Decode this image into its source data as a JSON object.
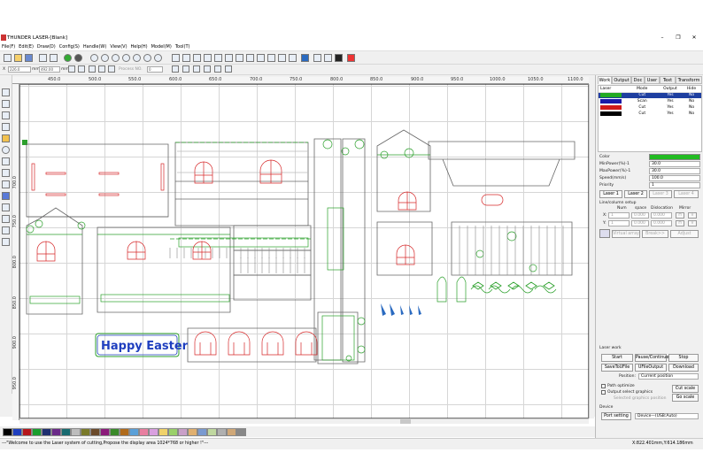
{
  "title": "THUNDER LASER-[Blank]",
  "window_controls": [
    "–",
    "❐",
    "✕"
  ],
  "menu": [
    "File(F)",
    "Edit(E)",
    "Draw(D)",
    "Config(S)",
    "Handle(W)",
    "View(V)",
    "Help(H)",
    "Model(M)",
    "Tool(T)"
  ],
  "toolbar2": {
    "x_label": "X",
    "x_val": "226.0",
    "x_unit": "mm",
    "y_label": "Y",
    "y_val": "320",
    "w_val": "492.00",
    "h_val": "138.966",
    "unit": "mm",
    "process_label": "Process NO.",
    "process_val": "0"
  },
  "ruler_top": [
    "450.0",
    "500.0",
    "550.0",
    "600.0",
    "650.0",
    "700.0",
    "750.0",
    "800.0",
    "850.0",
    "900.0",
    "950.0",
    "1000.0",
    "1050.0",
    "1100.0"
  ],
  "ruler_left": [
    "700.0",
    "750.0",
    "800.0",
    "850.0",
    "900.0",
    "950.0"
  ],
  "canvas_text": {
    "happy_easter": "Happy Easter"
  },
  "palette": [
    "#000000",
    "#1f3fbf",
    "#b5161b",
    "#1b9e2e",
    "#1f2f70",
    "#6a2a88",
    "#186b70",
    "#bdbdbd",
    "#7a7a2a",
    "#6b4a2b",
    "#8b1a7a",
    "#3a8a2a",
    "#b06a1a",
    "#5aa0d8",
    "#e87fa0",
    "#d9a0e0",
    "#f0d26a",
    "#9ad06a",
    "#c9a0c8",
    "#e0b070",
    "#7a9ad0",
    "#c0d8a0",
    "#b0b0b0",
    "#d0a878",
    "#888888"
  ],
  "status": {
    "message": "---\"Welcome to use the Laser system of cutting,Propose the display area 1024*768 or higher !\"---",
    "coords": "X:822.401mm,Y:614.186mm"
  },
  "panel": {
    "tabs": [
      "Work",
      "Output",
      "Doc",
      "User",
      "Text",
      "Transform"
    ],
    "layer_headers": [
      "Laser",
      "Mode",
      "Output",
      "Hide"
    ],
    "layers": [
      {
        "color": "#22aa22",
        "mode": "Cut",
        "output": "Yes",
        "hide": "No",
        "selected": true
      },
      {
        "color": "#1a1aa8",
        "mode": "Scan",
        "output": "Yes",
        "hide": "No",
        "selected": false
      },
      {
        "color": "#d01a1a",
        "mode": "Cut",
        "output": "Yes",
        "hide": "No",
        "selected": false
      },
      {
        "color": "#000000",
        "mode": "Cut",
        "output": "Yes",
        "hide": "No",
        "selected": false
      }
    ],
    "color_label": "Color",
    "color_value": "#22bb22",
    "min_power_label": "MinPower(%)-1",
    "min_power": "30.0",
    "max_power_label": "MaxPower(%)-1",
    "max_power": "30.0",
    "speed_label": "Speed(mm/s)",
    "speed": "100.0",
    "priority_label": "Priority",
    "priority": "1",
    "laser_tabs": [
      "Laser 1",
      "Laser 2",
      "Laser 3",
      "Laser 4"
    ],
    "line_col_label": "Line/column setup",
    "lc_headers": [
      "Num",
      "space",
      "Dislocation",
      "Mirror"
    ],
    "x_label": "X:",
    "y_label": "Y:",
    "lc_num": "1",
    "lc_space": "0.000",
    "lc_disloc": "0.000",
    "mirror_h": "H",
    "mirror_v": "V",
    "virtual_array": "Virtual array",
    "break_btn": "Break>>",
    "adjust_btn": "Adjust",
    "laser_work_label": "Laser work",
    "start": "Start",
    "pause": "Pause/Continue",
    "stop": "Stop",
    "save_to_file": "SaveToUFile",
    "ufile_output": "UFileOutput",
    "download": "Download",
    "position_label": "Position:",
    "position_val": "Current position",
    "path_optimize": "Path optimize",
    "output_select": "Output select graphics",
    "selected_range": "Selected graphics position",
    "cut_scale": "Cut scale",
    "go_scale": "Go scale",
    "device_label": "Device",
    "port_setting": "Port setting",
    "device_val": "Device—(USB:Auto)"
  }
}
